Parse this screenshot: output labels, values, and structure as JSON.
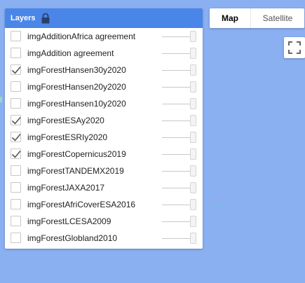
{
  "layers_panel": {
    "title": "Layers",
    "icon": "lock-icon",
    "items": [
      {
        "label": "imgAdditionAfrica agreement",
        "checked": false,
        "opacity": 1.0
      },
      {
        "label": "imgAddition agreement",
        "checked": false,
        "opacity": 1.0
      },
      {
        "label": "imgForestHansen30y2020",
        "checked": true,
        "opacity": 1.0
      },
      {
        "label": "imgForestHansen20y2020",
        "checked": false,
        "opacity": 1.0
      },
      {
        "label": "imgForestHansen10y2020",
        "checked": false,
        "opacity": 1.0
      },
      {
        "label": "imgForestESAy2020",
        "checked": true,
        "opacity": 1.0
      },
      {
        "label": "imgForestESRIy2020",
        "checked": true,
        "opacity": 1.0
      },
      {
        "label": "imgForestCopernicus2019",
        "checked": true,
        "opacity": 1.0
      },
      {
        "label": "imgForestTANDEMX2019",
        "checked": false,
        "opacity": 1.0
      },
      {
        "label": "imgForestJAXA2017",
        "checked": false,
        "opacity": 1.0
      },
      {
        "label": "imgForestAfriCoverESA2016",
        "checked": false,
        "opacity": 1.0
      },
      {
        "label": "imgForestLCESA2009",
        "checked": false,
        "opacity": 1.0
      },
      {
        "label": "imgForestGlobland2010",
        "checked": false,
        "opacity": 1.0
      }
    ]
  },
  "map_type": {
    "map_label": "Map",
    "satellite_label": "Satellite",
    "selected": "Map"
  },
  "controls": {
    "fullscreen_icon": "fullscreen-icon"
  },
  "colors": {
    "header": "#4a86e8",
    "map_background": "#8ab0f2"
  }
}
